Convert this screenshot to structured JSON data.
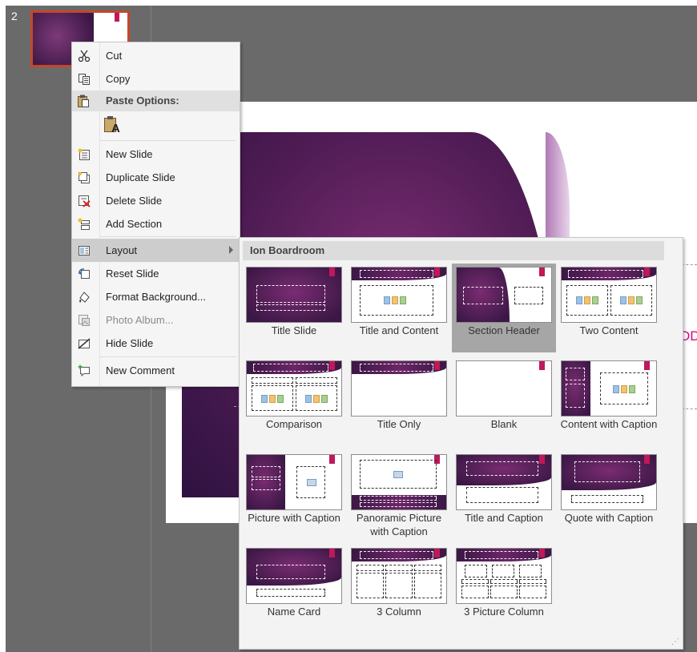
{
  "thumbnails": {
    "slide_number": "2"
  },
  "slide": {
    "partial_text": "DD"
  },
  "context_menu": {
    "items": [
      {
        "label": "Cut",
        "icon": "scissors-icon"
      },
      {
        "label": "Copy",
        "icon": "copy-icon"
      },
      {
        "label": "Paste Options:",
        "icon": "paste-icon"
      },
      {
        "label": "New Slide",
        "icon": "new-slide-icon"
      },
      {
        "label": "Duplicate Slide",
        "icon": "duplicate-slide-icon"
      },
      {
        "label": "Delete Slide",
        "icon": "delete-slide-icon"
      },
      {
        "label": "Add Section",
        "icon": "add-section-icon"
      },
      {
        "label": "Layout",
        "icon": "layout-icon"
      },
      {
        "label": "Reset Slide",
        "icon": "reset-slide-icon"
      },
      {
        "label": "Format Background...",
        "icon": "format-background-icon"
      },
      {
        "label": "Photo Album...",
        "icon": "photo-album-icon"
      },
      {
        "label": "Hide Slide",
        "icon": "hide-slide-icon"
      },
      {
        "label": "New Comment",
        "icon": "new-comment-icon"
      }
    ],
    "paste_keep_text_glyph": "A"
  },
  "layout_gallery": {
    "theme_name": "Ion Boardroom",
    "selected": "Section Header",
    "layouts": [
      {
        "label": "Title Slide"
      },
      {
        "label": "Title and Content"
      },
      {
        "label": "Section Header"
      },
      {
        "label": "Two Content"
      },
      {
        "label": "Comparison"
      },
      {
        "label": "Title Only"
      },
      {
        "label": "Blank"
      },
      {
        "label": "Content with Caption"
      },
      {
        "label": "Picture with Caption"
      },
      {
        "label": "Panoramic Picture with Caption"
      },
      {
        "label": "Title and Caption"
      },
      {
        "label": "Quote with Caption"
      },
      {
        "label": "Name Card"
      },
      {
        "label": "3 Column"
      },
      {
        "label": "3 Picture Column"
      }
    ]
  },
  "colors": {
    "thumbnail_selection": "#c4472a",
    "theme_purple": "#4c1b52",
    "theme_accent": "#c0185a",
    "menu_highlight": "#cdcdcd"
  }
}
